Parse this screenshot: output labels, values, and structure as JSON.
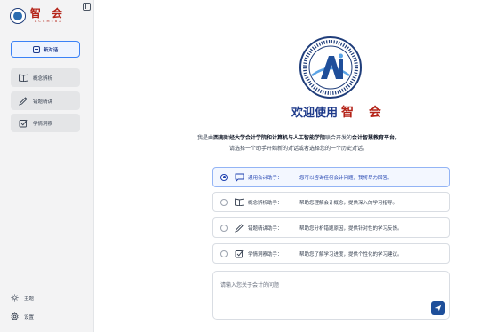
{
  "sidebar": {
    "logo": {
      "brand": "智 会",
      "subtitle": "A C C M E B A"
    },
    "new_chat_label": "新对话",
    "nav_items": [
      {
        "label": "概念辨析",
        "icon": "book-open-icon"
      },
      {
        "label": "错题精讲",
        "icon": "pen-icon"
      },
      {
        "label": "学情洞察",
        "icon": "checkbox-icon"
      }
    ],
    "bottom": [
      {
        "label": "主题",
        "icon": "sun-icon"
      },
      {
        "label": "设置",
        "icon": "gear-icon"
      }
    ]
  },
  "main": {
    "welcome_text": "欢迎使用",
    "welcome_brand": "智 会",
    "intro": {
      "prefix": "我是由",
      "school": "西南财经大学会计学院和计算机与人工智能学院",
      "middle": "联合开发的",
      "platform": "会计智慧教育平台。",
      "line2": "请选择一个助手开始新的对话或者选择您的一个历史对话。"
    },
    "assistants": [
      {
        "name": "通用会计助手：",
        "desc": "您可以咨询任何会计问题，我将尽力回答。",
        "icon": "chat-bubble-icon",
        "selected": true
      },
      {
        "name": "概念辨析助手：",
        "desc": "帮助您理解会计概念，提供深入的学习指导。",
        "icon": "book-open-icon",
        "selected": false
      },
      {
        "name": "错题精讲助手：",
        "desc": "帮助您分析错题原因，提供针对性的学习反馈。",
        "icon": "pen-icon",
        "selected": false
      },
      {
        "name": "学情洞察助手：",
        "desc": "帮助您了解学习进度，提供个性化的学习建议。",
        "icon": "checkbox-icon",
        "selected": false
      }
    ],
    "input": {
      "placeholder": "请输入您关于会计的问题",
      "value": ""
    },
    "send_icon": "send-icon"
  },
  "colors": {
    "brand_blue": "#1e3a8a",
    "brand_red": "#b42318",
    "selected_border": "#93b4f5",
    "send_button": "#1e4f9a"
  }
}
